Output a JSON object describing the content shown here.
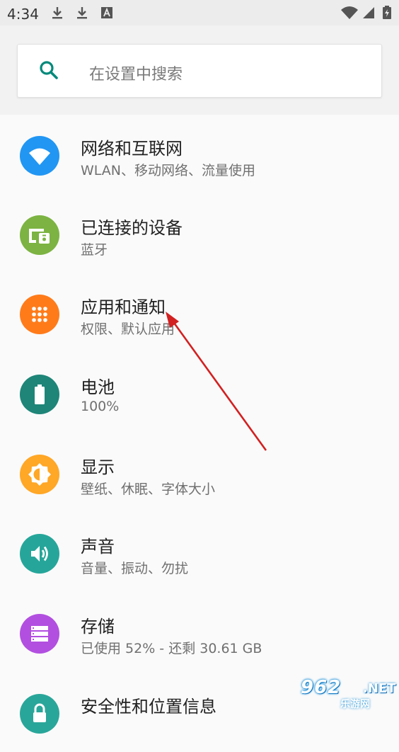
{
  "status_bar": {
    "time": "4:34",
    "icons": [
      "download-icon",
      "download-icon",
      "font-a-icon",
      "wifi-icon",
      "cellular-icon",
      "battery-icon"
    ]
  },
  "search": {
    "placeholder": "在设置中搜索",
    "icon": "search-icon",
    "accent_color": "#00897b"
  },
  "settings": [
    {
      "title": "网络和互联网",
      "subtitle": "WLAN、移动网络、流量使用",
      "icon": "wifi-icon",
      "color": "#2196f3"
    },
    {
      "title": "已连接的设备",
      "subtitle": "蓝牙",
      "icon": "devices-icon",
      "color": "#7cb342"
    },
    {
      "title": "应用和通知",
      "subtitle": "权限、默认应用",
      "icon": "apps-icon",
      "color": "#ff7b1a"
    },
    {
      "title": "电池",
      "subtitle": "100%",
      "icon": "battery-icon",
      "color": "#1e8578"
    },
    {
      "title": "显示",
      "subtitle": "壁纸、休眠、字体大小",
      "icon": "brightness-icon",
      "color": "#ffa726"
    },
    {
      "title": "声音",
      "subtitle": "音量、振动、勿扰",
      "icon": "volume-icon",
      "color": "#26a69a"
    },
    {
      "title": "存储",
      "subtitle": "已使用 52% - 还剩 30.61 GB",
      "icon": "storage-icon",
      "color": "#b24fe0"
    },
    {
      "title": "安全性和位置信息",
      "subtitle": "",
      "icon": "lock-icon",
      "color": "#29a69a"
    }
  ],
  "watermark": {
    "number": "962",
    "domain": ".NET",
    "site": "乐游网"
  }
}
